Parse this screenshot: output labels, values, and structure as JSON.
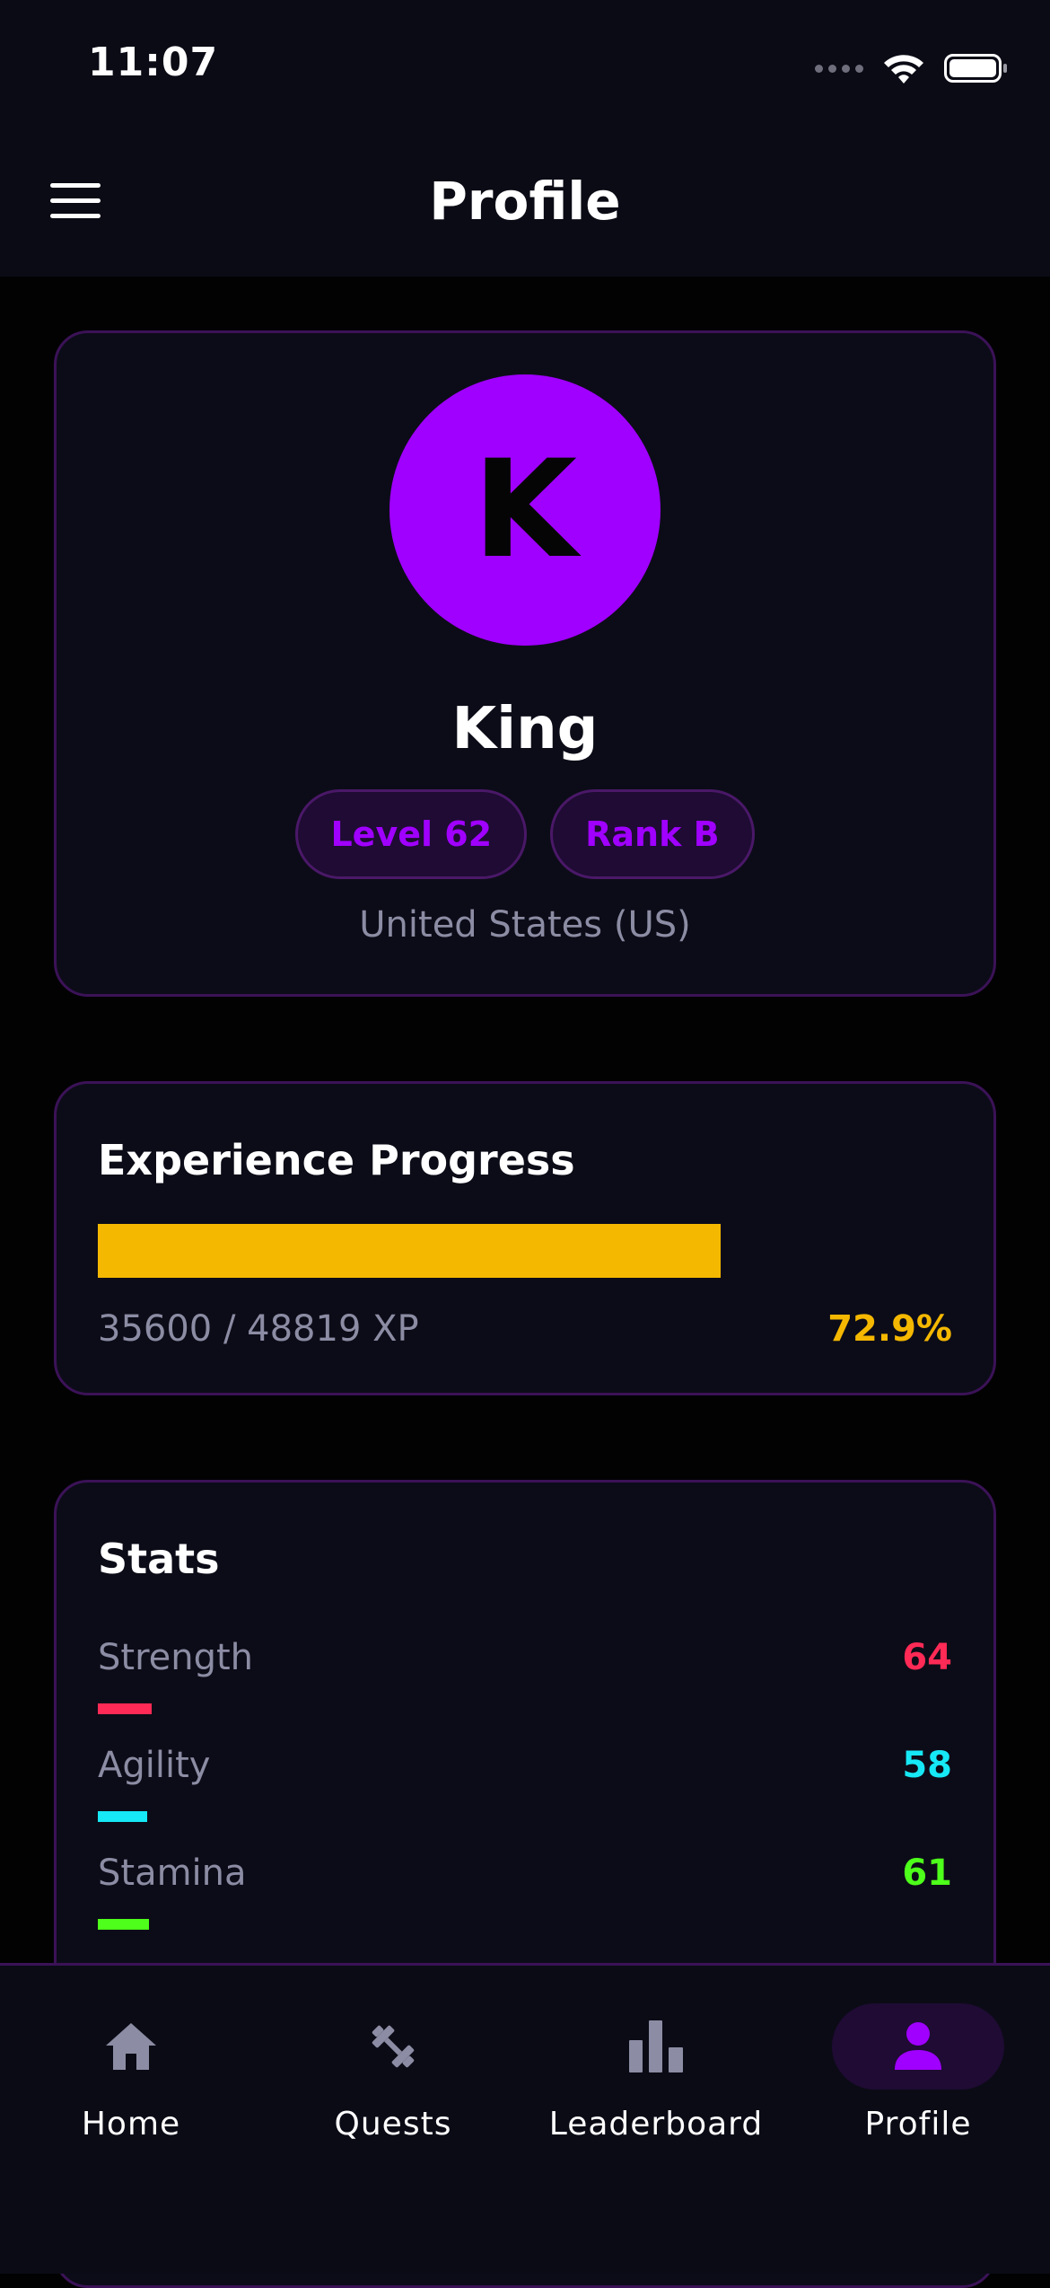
{
  "status_bar": {
    "time": "11:07"
  },
  "header": {
    "title": "Profile",
    "menu_icon": "hamburger-menu-icon"
  },
  "profile": {
    "avatar_letter": "K",
    "avatar_color": "#a000ff",
    "name": "King",
    "level_badge": "Level 62",
    "rank_badge": "Rank B",
    "country": "United States (US)"
  },
  "experience": {
    "title": "Experience Progress",
    "xp_text": "35600 / 48819 XP",
    "percent_text": "72.9%",
    "progress_fraction": 0.729,
    "bar_color": "#f5b800"
  },
  "stats": {
    "title": "Stats",
    "items": [
      {
        "label": "Strength",
        "value": "64",
        "color": "#ff2a55"
      },
      {
        "label": "Agility",
        "value": "58",
        "color": "#16e8f5"
      },
      {
        "label": "Stamina",
        "value": "61",
        "color": "#4dff1a"
      }
    ]
  },
  "bottom_nav": {
    "items": [
      {
        "label": "Home",
        "icon": "home-icon",
        "active": false
      },
      {
        "label": "Quests",
        "icon": "dumbbell-icon",
        "active": false
      },
      {
        "label": "Leaderboard",
        "icon": "bar-chart-icon",
        "active": false
      },
      {
        "label": "Profile",
        "icon": "person-icon",
        "active": true
      }
    ],
    "active_color": "#a000ff",
    "inactive_color": "#8c8ca4"
  }
}
